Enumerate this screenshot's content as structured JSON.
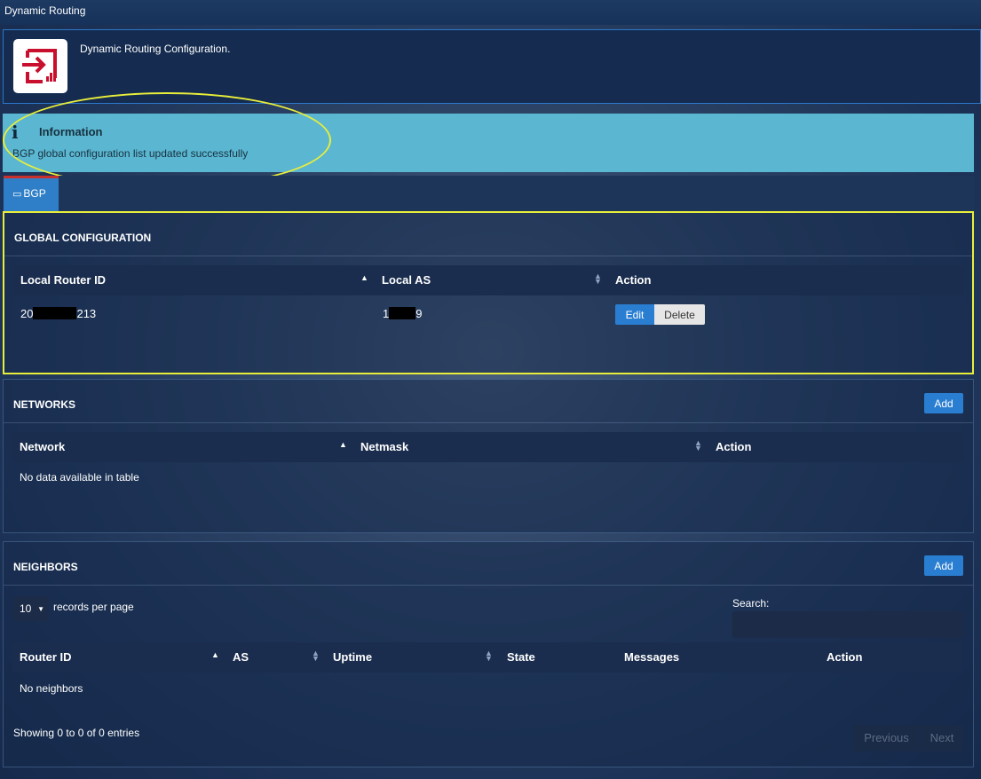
{
  "window": {
    "title": "Dynamic Routing"
  },
  "header": {
    "description": "Dynamic Routing Configuration."
  },
  "info": {
    "icon": "info-icon",
    "title": "Information",
    "message": "BGP global configuration list updated successfully"
  },
  "tabs": [
    {
      "label": "BGP",
      "icon": "inbox-icon"
    }
  ],
  "global": {
    "title": "GLOBAL CONFIGURATION",
    "columns": [
      "Local Router ID",
      "Local AS",
      "Action"
    ],
    "row": {
      "router_id_prefix": "20",
      "router_id_suffix": "213",
      "as_prefix": "1",
      "as_suffix": "9"
    },
    "edit_label": "Edit",
    "delete_label": "Delete"
  },
  "networks": {
    "title": "NETWORKS",
    "add_label": "Add",
    "columns": [
      "Network",
      "Netmask",
      "Action"
    ],
    "empty": "No data available in table"
  },
  "neighbors": {
    "title": "NEIGHBORS",
    "add_label": "Add",
    "page_size": "10",
    "records_label": "records per page",
    "search_label": "Search:",
    "search_value": "",
    "columns": [
      "Router ID",
      "AS",
      "Uptime",
      "State",
      "Messages",
      "Action"
    ],
    "empty": "No neighbors",
    "summary": "Showing 0 to 0 of 0 entries",
    "previous_label": "Previous",
    "next_label": "Next"
  },
  "colors": {
    "accent": "#2a7ed2",
    "info_background": "#5bb7d1",
    "highlight": "#e9ee3a",
    "logo_red": "#c8102e"
  }
}
